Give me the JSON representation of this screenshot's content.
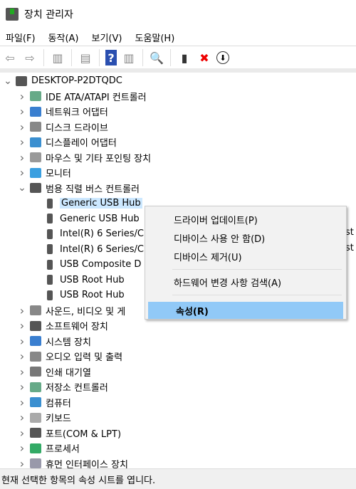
{
  "window": {
    "title": "장치 관리자"
  },
  "menu": [
    "파일(F)",
    "동작(A)",
    "보기(V)",
    "도움말(H)"
  ],
  "toolbar": [
    {
      "icon": "back-arrow-icon",
      "glyph": "⇦"
    },
    {
      "icon": "forward-arrow-icon",
      "glyph": "⇨"
    },
    "sep",
    {
      "icon": "show-hide-console-tree-icon",
      "glyph": "▥"
    },
    "sep",
    {
      "icon": "properties-icon",
      "glyph": "▤"
    },
    "sep",
    {
      "icon": "help-icon",
      "glyph": "?"
    },
    {
      "icon": "show-action-pane-icon",
      "glyph": "▥"
    },
    "sep",
    {
      "icon": "scan-hardware-icon",
      "glyph": "🔍"
    },
    "sep",
    {
      "icon": "update-driver-icon",
      "glyph": "▮"
    },
    {
      "icon": "uninstall-x-icon",
      "glyph": "✖"
    },
    {
      "icon": "disable-device-icon",
      "glyph": "⬇"
    }
  ],
  "tree": [
    {
      "label": "DESKTOP-P2DTQDC",
      "level": 0,
      "expand": "open",
      "color": "#555"
    },
    {
      "label": "IDE ATA/ATAPI 컨트롤러",
      "level": 1,
      "expand": "closed",
      "color": "#6a8"
    },
    {
      "label": "네트워크 어댑터",
      "level": 1,
      "expand": "closed",
      "color": "#3a7fd0"
    },
    {
      "label": "디스크 드라이브",
      "level": 1,
      "expand": "closed",
      "color": "#888"
    },
    {
      "label": "디스플레이 어댑터",
      "level": 1,
      "expand": "closed",
      "color": "#3a8fd0"
    },
    {
      "label": "마우스 및 기타 포인팅 장치",
      "level": 1,
      "expand": "closed",
      "color": "#999"
    },
    {
      "label": "모니터",
      "level": 1,
      "expand": "closed",
      "color": "#3a9fe0"
    },
    {
      "label": "범용 직렬 버스 컨트롤러",
      "level": 1,
      "expand": "open",
      "color": "#555"
    },
    {
      "label": "Generic USB Hub",
      "level": 2,
      "selected": true,
      "color": "#555"
    },
    {
      "label": "Generic USB Hub",
      "level": 2,
      "color": "#555"
    },
    {
      "label": "Intel(R) 6 Series/C",
      "level": 2,
      "color": "#555"
    },
    {
      "label": "Intel(R) 6 Series/C",
      "level": 2,
      "color": "#555"
    },
    {
      "label": "USB Composite D",
      "level": 2,
      "color": "#555"
    },
    {
      "label": "USB Root Hub",
      "level": 2,
      "color": "#555"
    },
    {
      "label": "USB Root Hub",
      "level": 2,
      "color": "#555"
    },
    {
      "label": "사운드, 비디오 및 게",
      "level": 1,
      "expand": "closed",
      "color": "#888"
    },
    {
      "label": "소프트웨어 장치",
      "level": 1,
      "expand": "closed",
      "color": "#555"
    },
    {
      "label": "시스템 장치",
      "level": 1,
      "expand": "closed",
      "color": "#3a7fd0"
    },
    {
      "label": "오디오 입력 및 출력",
      "level": 1,
      "expand": "closed",
      "color": "#888"
    },
    {
      "label": "인쇄 대기열",
      "level": 1,
      "expand": "closed",
      "color": "#777"
    },
    {
      "label": "저장소 컨트롤러",
      "level": 1,
      "expand": "closed",
      "color": "#6a8"
    },
    {
      "label": "컴퓨터",
      "level": 1,
      "expand": "closed",
      "color": "#3a8fd0"
    },
    {
      "label": "키보드",
      "level": 1,
      "expand": "closed",
      "color": "#aaa"
    },
    {
      "label": "포트(COM & LPT)",
      "level": 1,
      "expand": "closed",
      "color": "#555"
    },
    {
      "label": "프로세서",
      "level": 1,
      "expand": "closed",
      "color": "#3a6"
    },
    {
      "label": "휴먼 인터페이스 장치",
      "level": 1,
      "expand": "closed",
      "color": "#99a"
    }
  ],
  "hidden_suffix": "st",
  "context_menu": {
    "items": [
      {
        "label": "드라이버 업데이트(P)"
      },
      {
        "label": "디바이스 사용 안 함(D)"
      },
      {
        "label": "디바이스 제거(U)"
      },
      {
        "separator": true
      },
      {
        "label": "하드웨어 변경 사항 검색(A)"
      },
      {
        "separator": true
      },
      {
        "label": "속성(R)",
        "highlighted": true
      }
    ]
  },
  "status": "현재 선택한 항목의 속성 시트를 엽니다."
}
